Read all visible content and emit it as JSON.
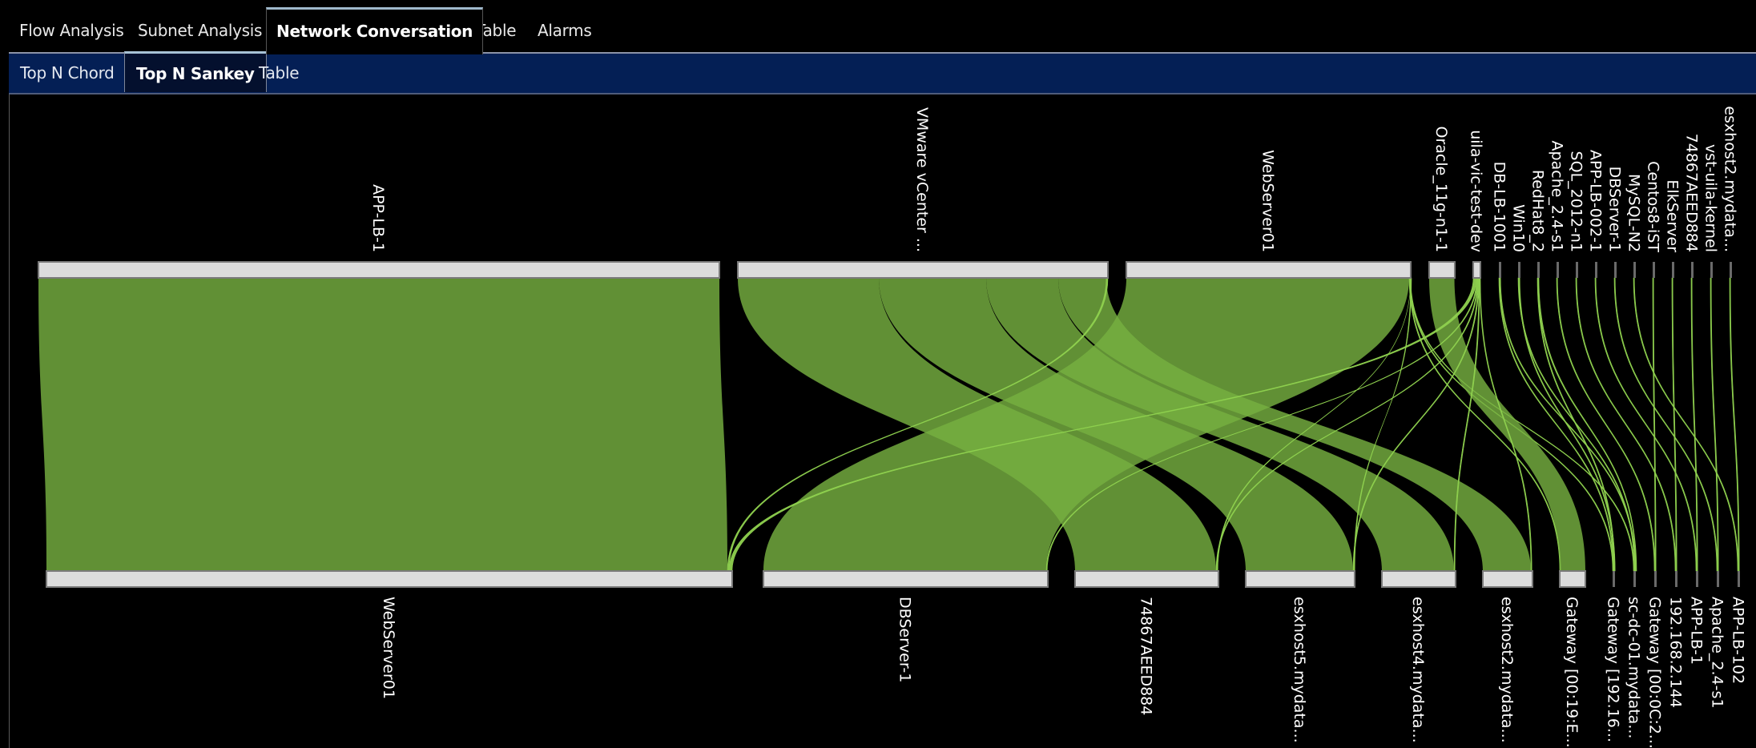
{
  "top_tabs": [
    {
      "label": "Flow Analysis",
      "active": false
    },
    {
      "label": "Subnet Analysis",
      "active": false
    },
    {
      "label": "Network Conversation",
      "active": true
    },
    {
      "label": "Table",
      "active": false
    },
    {
      "label": "Alarms",
      "active": false
    }
  ],
  "sub_tabs": [
    {
      "label": "Top N Chord",
      "active": false
    },
    {
      "label": "Top N Sankey",
      "active": true
    },
    {
      "label": "Table",
      "active": false
    }
  ],
  "colors": {
    "flow": "#76b041",
    "flow_highlight": "#8fd14f",
    "node_fill": "#dcdcdc",
    "node_stroke": "#7a7a7a",
    "sub_bar": "#041f55"
  },
  "chart_data": {
    "type": "sankey",
    "title": "",
    "orientation": "vertical",
    "sources": [
      {
        "id": "s0",
        "label": "APP-LB-1",
        "value": 850
      },
      {
        "id": "s1",
        "label": "VMware vCenter ...",
        "value": 462
      },
      {
        "id": "s2",
        "label": "WebServer01",
        "value": 355
      },
      {
        "id": "s3",
        "label": "Oracle_11g-n1-1",
        "value": 32
      },
      {
        "id": "s4",
        "label": "uila-vic-test-dev",
        "value": 9
      },
      {
        "id": "s5",
        "label": "DB-LB-1001",
        "value": 2
      },
      {
        "id": "s6",
        "label": "Win10",
        "value": 2
      },
      {
        "id": "s7",
        "label": "RedHat8_2",
        "value": 2
      },
      {
        "id": "s8",
        "label": "Apache_2.4-s1",
        "value": 2
      },
      {
        "id": "s9",
        "label": "SQL_2012-n1",
        "value": 2
      },
      {
        "id": "s10",
        "label": "APP-LB-002-1",
        "value": 2
      },
      {
        "id": "s11",
        "label": "DBServer-1",
        "value": 2
      },
      {
        "id": "s12",
        "label": "MySQL-N2",
        "value": 2
      },
      {
        "id": "s13",
        "label": "Centos8-iST",
        "value": 2
      },
      {
        "id": "s14",
        "label": "ElkServer",
        "value": 2
      },
      {
        "id": "s15",
        "label": "74867AEED884",
        "value": 2
      },
      {
        "id": "s16",
        "label": "vst-uila-kernel",
        "value": 2
      },
      {
        "id": "s17",
        "label": "esxhost2.mydata...",
        "value": 2
      }
    ],
    "targets": [
      {
        "id": "t0",
        "label": "WebServer01",
        "value": 856
      },
      {
        "id": "t1",
        "label": "DBServer-1",
        "value": 355
      },
      {
        "id": "t2",
        "label": "74867AEED884",
        "value": 179
      },
      {
        "id": "t3",
        "label": "esxhost5.mydata...",
        "value": 136
      },
      {
        "id": "t4",
        "label": "esxhost4.mydata...",
        "value": 92
      },
      {
        "id": "t5",
        "label": "esxhost2.mydata...",
        "value": 62
      },
      {
        "id": "t6",
        "label": "Gateway [00:19:E...",
        "value": 32
      },
      {
        "id": "t7",
        "label": "Gateway [192.16...",
        "value": 2
      },
      {
        "id": "t8",
        "label": "sc-dc-01.mydata...",
        "value": 2
      },
      {
        "id": "t9",
        "label": "Gateway [00:0C:2...",
        "value": 2
      },
      {
        "id": "t10",
        "label": "192.168.2.144",
        "value": 2
      },
      {
        "id": "t11",
        "label": "APP-LB-1",
        "value": 2
      },
      {
        "id": "t12",
        "label": "Apache_2.4-s1",
        "value": 2
      },
      {
        "id": "t13",
        "label": "APP-LB-102",
        "value": 2
      }
    ],
    "links": [
      {
        "source": "s0",
        "target": "t0",
        "value": 850
      },
      {
        "source": "s1",
        "target": "t2",
        "value": 176
      },
      {
        "source": "s1",
        "target": "t3",
        "value": 134
      },
      {
        "source": "s1",
        "target": "t4",
        "value": 90
      },
      {
        "source": "s1",
        "target": "t5",
        "value": 60
      },
      {
        "source": "s1",
        "target": "t0",
        "value": 2
      },
      {
        "source": "s2",
        "target": "t1",
        "value": 353
      },
      {
        "source": "s2",
        "target": "t6",
        "value": 0.5
      },
      {
        "source": "s2",
        "target": "t7",
        "value": 0.5
      },
      {
        "source": "s2",
        "target": "t8",
        "value": 1
      },
      {
        "source": "s3",
        "target": "t6",
        "value": 31.5
      },
      {
        "source": "s4",
        "target": "t0",
        "value": 4
      },
      {
        "source": "s4",
        "target": "t1",
        "value": 1
      },
      {
        "source": "s4",
        "target": "t2",
        "value": 1
      },
      {
        "source": "s4",
        "target": "t3",
        "value": 1
      },
      {
        "source": "s4",
        "target": "t4",
        "value": 1
      },
      {
        "source": "s4",
        "target": "t5",
        "value": 1
      },
      {
        "source": "s5",
        "target": "t7",
        "value": 1
      },
      {
        "source": "s6",
        "target": "t8",
        "value": 1
      },
      {
        "source": "s7",
        "target": "t7",
        "value": 0.5
      },
      {
        "source": "s8",
        "target": "t9",
        "value": 1
      },
      {
        "source": "s9",
        "target": "t10",
        "value": 1
      },
      {
        "source": "s10",
        "target": "t11",
        "value": 1
      },
      {
        "source": "s11",
        "target": "t12",
        "value": 1
      },
      {
        "source": "s12",
        "target": "t13",
        "value": 1
      },
      {
        "source": "s13",
        "target": "t9",
        "value": 1
      },
      {
        "source": "s14",
        "target": "t10",
        "value": 1
      },
      {
        "source": "s15",
        "target": "t11",
        "value": 1
      },
      {
        "source": "s16",
        "target": "t12",
        "value": 1
      },
      {
        "source": "s17",
        "target": "t13",
        "value": 1
      },
      {
        "source": "s2",
        "target": "t2",
        "value": 1
      },
      {
        "source": "s2",
        "target": "t3",
        "value": 1
      },
      {
        "source": "s5",
        "target": "t8",
        "value": 1
      },
      {
        "source": "s6",
        "target": "t7",
        "value": 1
      },
      {
        "source": "s7",
        "target": "t8",
        "value": 1.5
      }
    ]
  }
}
